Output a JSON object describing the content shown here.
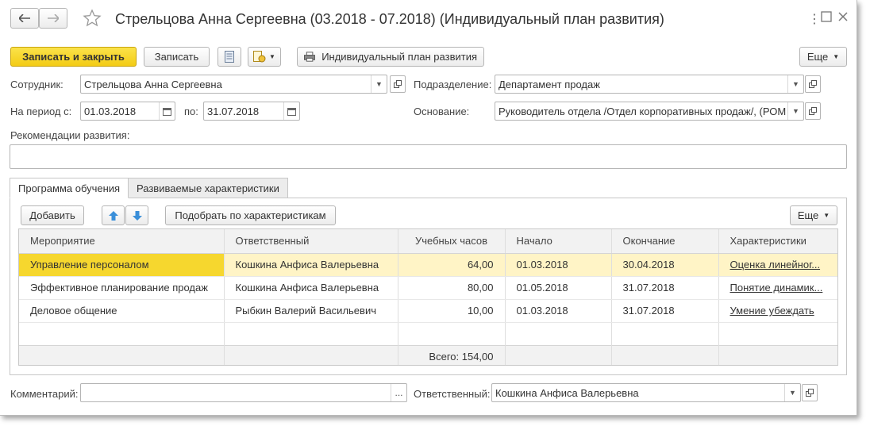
{
  "window": {
    "title": "Стрельцова Анна Сергеевна (03.2018 - 07.2018) (Индивидуальный план развития)"
  },
  "toolbar": {
    "save_close": "Записать и закрыть",
    "save": "Записать",
    "print_plan": "Индивидуальный план развития",
    "more": "Еще"
  },
  "form": {
    "employee_label": "Сотрудник:",
    "employee_value": "Стрельцова Анна Сергеевна",
    "department_label": "Подразделение:",
    "department_value": "Департамент продаж",
    "period_label": "На период с:",
    "period_from": "01.03.2018",
    "period_to_label": "по:",
    "period_to": "31.07.2018",
    "basis_label": "Основание:",
    "basis_value": "Руководитель отдела /Отдел корпоративных продаж/, (РОМ",
    "recommendations_label": "Рекомендации развития:",
    "recommendations_value": ""
  },
  "tabs": [
    {
      "label": "Программа обучения",
      "active": true
    },
    {
      "label": "Развиваемые характеристики",
      "active": false
    }
  ],
  "table_toolbar": {
    "add": "Добавить",
    "pick": "Подобрать по характеристикам",
    "more": "Еще"
  },
  "table": {
    "columns": [
      "Мероприятие",
      "Ответственный",
      "Учебных часов",
      "Начало",
      "Окончание",
      "Характеристики"
    ],
    "rows": [
      [
        "Управление персоналом",
        "Кошкина Анфиса Валерьевна",
        "64,00",
        "01.03.2018",
        "30.04.2018",
        "Оценка линейног..."
      ],
      [
        "Эффективное планирование продаж",
        "Кошкина Анфиса Валерьевна",
        "80,00",
        "01.05.2018",
        "31.07.2018",
        "Понятие динамик..."
      ],
      [
        "Деловое общение",
        "Рыбкин Валерий Васильевич",
        "10,00",
        "01.03.2018",
        "31.07.2018",
        "Умение убеждать"
      ]
    ],
    "total": "Всего: 154,00"
  },
  "footer": {
    "comment_label": "Комментарий:",
    "comment_value": "",
    "responsible_label": "Ответственный:",
    "responsible_value": "Кошкина Анфиса Валерьевна"
  },
  "colors": {
    "accent_yellow": "#f6d72e",
    "selected_row": "#fff4c6",
    "nav_arrow_blue": "#3a8fd9"
  }
}
